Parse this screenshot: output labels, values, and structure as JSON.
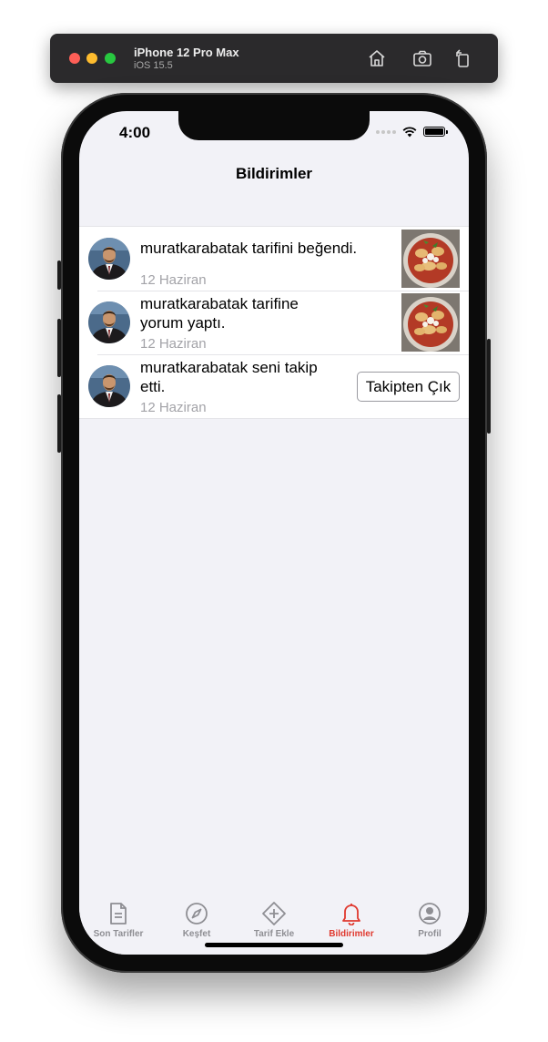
{
  "simulator": {
    "device": "iPhone 12 Pro Max",
    "os": "iOS 15.5",
    "icons": [
      "home-icon",
      "screenshot-icon",
      "rotate-icon"
    ]
  },
  "status_bar": {
    "time": "4:00"
  },
  "nav": {
    "title": "Bildirimler"
  },
  "notifications": [
    {
      "user": "muratkarabatak",
      "text": "muratkarabatak tarifini beğendi.",
      "date": "12 Haziran",
      "thumb": "recipe-thumbnail"
    },
    {
      "user": "muratkarabatak",
      "text": "muratkarabatak tarifine yorum yaptı.",
      "date": "12 Haziran",
      "thumb": "recipe-thumbnail"
    },
    {
      "user": "muratkarabatak",
      "text": "muratkarabatak seni takip etti.",
      "date": "12 Haziran",
      "button": "Takipten Çık"
    }
  ],
  "tabbar": {
    "items": [
      {
        "label": "Son Tarifler",
        "icon": "document-icon"
      },
      {
        "label": "Keşfet",
        "icon": "compass-icon"
      },
      {
        "label": "Tarif Ekle",
        "icon": "add-diamond-icon"
      },
      {
        "label": "Bildirimler",
        "icon": "bell-icon"
      },
      {
        "label": "Profil",
        "icon": "user-circle-icon"
      }
    ],
    "active_index": 3
  },
  "colors": {
    "accent": "#e0392f",
    "inactive": "#8e8e93",
    "background": "#f2f2f7"
  }
}
